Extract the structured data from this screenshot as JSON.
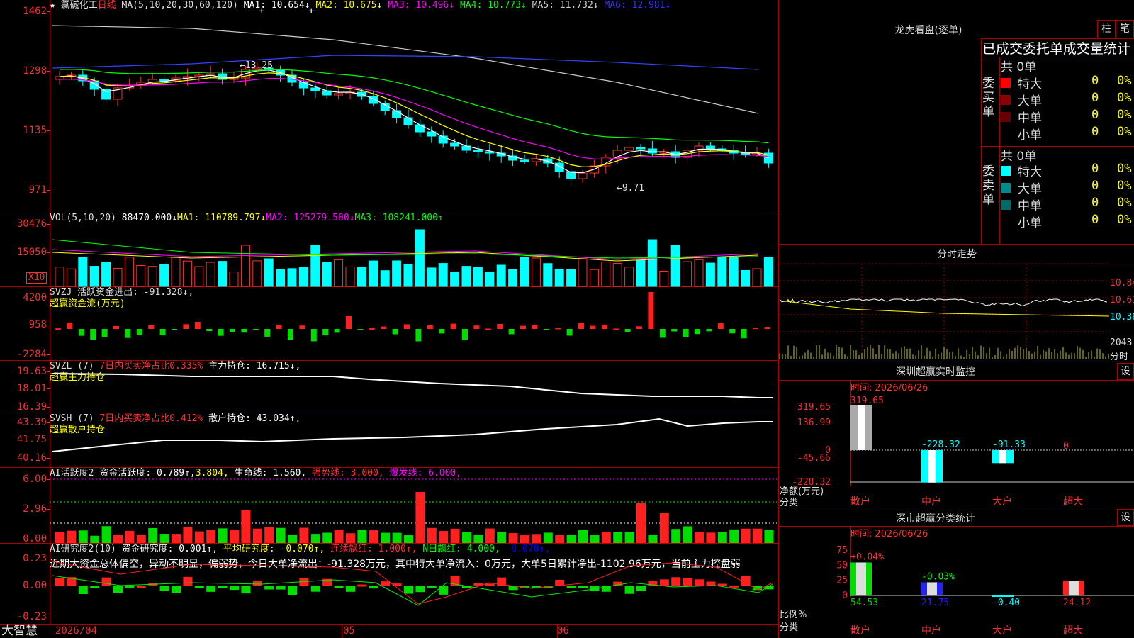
{
  "stock": {
    "name": "氯碱化工",
    "period": "日线"
  },
  "main": {
    "ma_label": "MA(5,10,20,30,60,120)",
    "ma": [
      {
        "label": "MA1: 10.654↓",
        "color": "#ffffff"
      },
      {
        "label": "MA2: 10.675↓",
        "color": "#ffff00"
      },
      {
        "label": "MA3: 10.496↓",
        "color": "#ff00ff"
      },
      {
        "label": "MA4: 10.773↓",
        "color": "#00ff00"
      },
      {
        "label": "MA5: 11.732↓",
        "color": "#cccccc"
      },
      {
        "label": "MA6: 12.981↓",
        "color": "#3333ff"
      }
    ],
    "y_labels": [
      "1462",
      "1298",
      "1135",
      "971"
    ],
    "hi_label": "←13.25",
    "lo_label": "←9.71"
  },
  "vol": {
    "label": "VOL(5,10,20)",
    "value": "88470.000↓",
    "ma1": "MA1: 110789.797↓",
    "ma2": "MA2: 125279.500↓",
    "ma3": "MA3: 108241.000↑",
    "y_labels": [
      "30476",
      "15050"
    ],
    "unit": "X10"
  },
  "svzj": {
    "label": "SVZJ",
    "desc": "活跃资金进出: -91.328↓,",
    "sub": "超赢资金流(万元)",
    "y_labels": [
      "4200",
      "958",
      "-2284"
    ]
  },
  "svzl": {
    "label": "SVZL (7)",
    "desc": "7日内买卖净占比0.335%",
    "hold": "主力持仓: 16.715↓,",
    "sub": "超赢主力持仓",
    "y_labels": [
      "19.63",
      "18.01",
      "16.39"
    ]
  },
  "svsh": {
    "label": "SVSH (7)",
    "desc": "7日内买卖净占比0.412%",
    "hold": "散户持仓: 43.034↑,",
    "sub": "超赢散户持仓",
    "y_labels": [
      "43.39",
      "41.75",
      "40.16"
    ]
  },
  "ai2": {
    "label": "AI活跃度2",
    "fund": "资金活跃度: 0.789↑,",
    "v2": "3.804,",
    "life": "生命线: 1.560,",
    "strong": "强势线: 3.000,",
    "burst": "爆发线: 6.000,",
    "y_labels": [
      "6.00",
      "2.96",
      "0.00"
    ]
  },
  "ai_r": {
    "label": "AI研究度2(10)",
    "fund": "资金研究度: 0.001↑,",
    "avg": "平均研究度: -0.070↑,",
    "lian": "连续飘红: 1.000↑,",
    "nday": "N日飘红: 4.000,",
    "last": "-0.070↑,",
    "comment": "近期大资金总体偏空，异动不明显，偏弱势，今日大单净流出：-91.328万元，其中特大单净流入：0万元，大单5日累计净出-1102.96万元，当前主力控盘弱",
    "y_labels": [
      "0.23",
      "0.00",
      "-0.23"
    ]
  },
  "footer": {
    "brand": "大智慧",
    "date": "2026/04",
    "m05": "05",
    "m06": "06"
  },
  "longhu": {
    "title": "龙虎看盘(逐单)",
    "btn1": "柱",
    "btn2": "笔",
    "subtitle": "已成交委托单成交量统计",
    "buy_side": "委买单",
    "sell_side": "委卖单",
    "buy_total": "共 0单",
    "sell_total": "共 0单",
    "buy": [
      {
        "label": "特大",
        "color": "#ff0000",
        "v": "0",
        "p": "0%"
      },
      {
        "label": "大单",
        "color": "#8b0000",
        "v": "0",
        "p": "0%"
      },
      {
        "label": "中单",
        "color": "#660000",
        "v": "0",
        "p": "0%"
      },
      {
        "label": "小单",
        "color": "#000000",
        "v": "0",
        "p": "0%"
      }
    ],
    "sell": [
      {
        "label": "特大",
        "color": "#00ffff",
        "v": "0",
        "p": "0%"
      },
      {
        "label": "大单",
        "color": "#008b8b",
        "v": "0",
        "p": "0%"
      },
      {
        "label": "中单",
        "color": "#006a6a",
        "v": "0",
        "p": "0%"
      },
      {
        "label": "小单",
        "color": "#000000",
        "v": "0",
        "p": "0%"
      }
    ]
  },
  "fenshi": {
    "title": "分时走势",
    "y_labels": [
      "10.84",
      "10.61",
      "10.38"
    ],
    "vol_label": "2043",
    "vol_unit": "分时"
  },
  "monitor": {
    "title": "深圳超赢实时监控",
    "btn": "设",
    "time": "时间: 2026/06/26",
    "y_labels": [
      "319.65",
      "136.99",
      "0",
      "-45.66",
      "-228.32"
    ],
    "net_label": "净额(万元)",
    "cat_label": "分类",
    "bars": [
      {
        "cat": "散户",
        "value": 319.65,
        "label": "319.65"
      },
      {
        "cat": "中户",
        "value": -228.32,
        "label": "-228.32"
      },
      {
        "cat": "大户",
        "value": -91.33,
        "label": "-91.33"
      },
      {
        "cat": "超大",
        "value": 0,
        "label": "0"
      }
    ]
  },
  "classify": {
    "title": "深市超赢分类统计",
    "btn": "设",
    "time": "时间: 2026/06/26",
    "y_labels": [
      "75",
      "50",
      "25",
      "0"
    ],
    "ratio_label": "比例%",
    "cat_label": "分类",
    "bars": [
      {
        "cat": "散户",
        "value": 54.53,
        "label": "54.53",
        "chg": "+0.04%"
      },
      {
        "cat": "中户",
        "value": 21.75,
        "label": "21.75",
        "chg": "-0.03%"
      },
      {
        "cat": "大户",
        "value": -0.4,
        "label": "-0.40",
        "chg": ""
      },
      {
        "cat": "超大",
        "value": 24.12,
        "label": "24.12",
        "chg": ""
      }
    ]
  }
}
